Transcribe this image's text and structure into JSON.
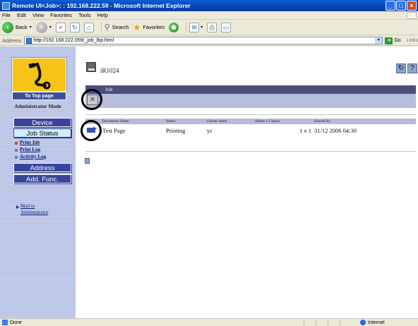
{
  "window": {
    "title": "Remote UI<Job>: : 192.168.222.59 - Microsoft Internet Explorer"
  },
  "menu": [
    "File",
    "Edit",
    "View",
    "Favorites",
    "Tools",
    "Help"
  ],
  "toolbar": {
    "back_label": "Back",
    "search_label": "Search",
    "favorites_label": "Favorites"
  },
  "address": {
    "label": "Address",
    "url": "http://192.168.222.059/_job_lbp.html",
    "go_label": "Go",
    "links_label": "Links"
  },
  "sidebar": {
    "top_page_label": "To Top page",
    "mode_label": "Administrator Mode",
    "nav": {
      "device": "Device",
      "job_status": "Job Status",
      "address": "Address",
      "add_func": "Add. Func."
    },
    "sublinks": [
      "Print Job",
      "Print Log",
      "Activity Log"
    ],
    "mail_admin_line1": "Mail to",
    "mail_admin_line2": "Administrator"
  },
  "main": {
    "device_name": "iR1024",
    "section_title_suffix": "Job"
  },
  "jobs_table": {
    "headers": [
      "Document Name",
      "Status",
      "Owner name",
      "Sheets x Copies",
      "Started At"
    ],
    "rows": [
      {
        "document_name": "Test Page",
        "status": "Printing",
        "owner": "yc",
        "sheets_copies": "1 x 1",
        "started_at": "31/12 2006 04:30"
      }
    ]
  },
  "statusbar": {
    "status": "Done",
    "zone": "Internet"
  },
  "colors": {
    "nav_button": "#39449b",
    "nav_active": "#cfeefe",
    "sidebar_bg": "#b9c3e6",
    "section_header": "#4c4e7d",
    "logo_bg": "#f7c316"
  }
}
